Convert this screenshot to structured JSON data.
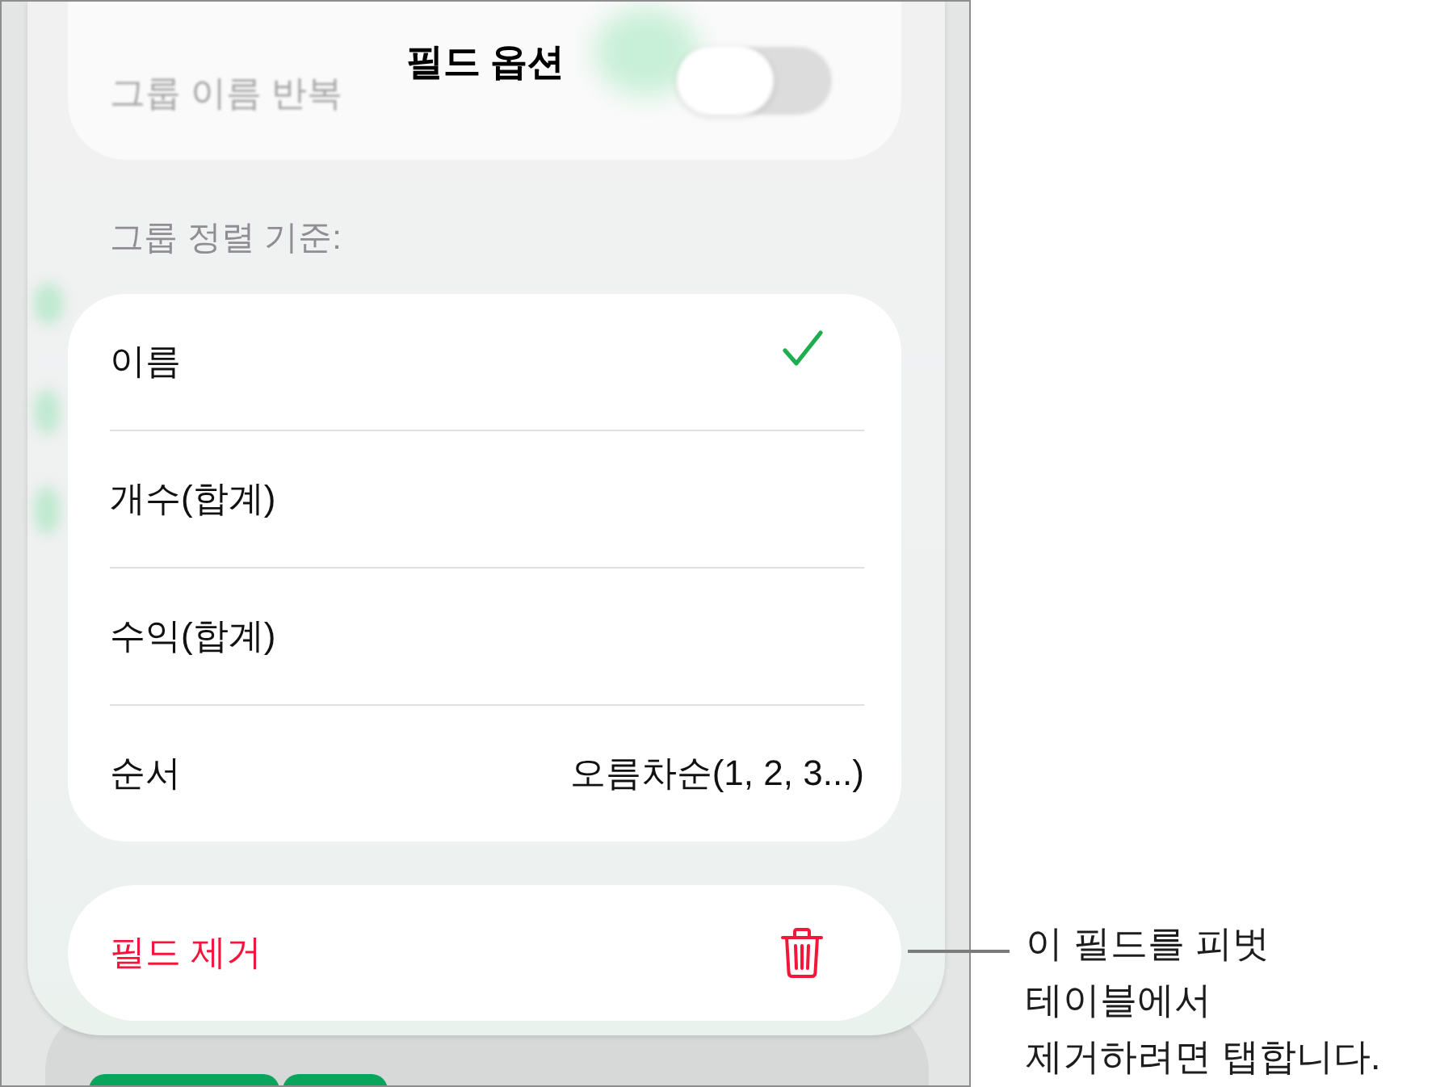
{
  "sheet": {
    "title": "필드 옵션"
  },
  "repeat_group_names": {
    "label": "그룹 이름 반복",
    "on": false
  },
  "sort_section": {
    "label": "그룹 정렬 기준:",
    "rows": [
      {
        "kind": "option",
        "label": "이름",
        "selected": true
      },
      {
        "kind": "option",
        "label": "개수(합계)",
        "selected": false
      },
      {
        "kind": "option",
        "label": "수익(합계)",
        "selected": false
      },
      {
        "kind": "value",
        "label": "순서",
        "value": "오름차순(1, 2, 3...)"
      }
    ]
  },
  "remove_button": {
    "label": "필드 제거"
  },
  "callout": {
    "text": "이 필드를 피벗\n테이블에서\n제거하려면 탭합니다."
  }
}
